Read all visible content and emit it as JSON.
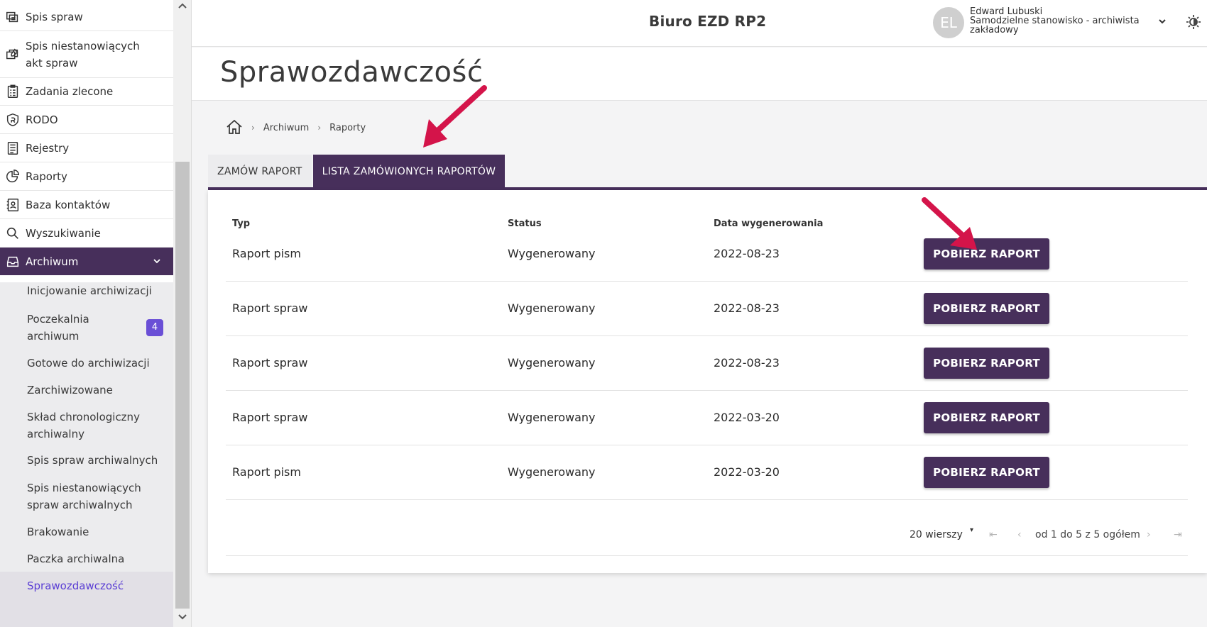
{
  "sidebar": {
    "items": [
      {
        "label": "Spis spraw",
        "icon": "folders-icon"
      },
      {
        "label": "Spis niestanowiących akt spraw",
        "icon": "folders-edit-icon"
      },
      {
        "label": "Zadania zlecone",
        "icon": "clipboard-icon"
      },
      {
        "label": "RODO",
        "icon": "shield-icon"
      },
      {
        "label": "Rejestry",
        "icon": "register-icon"
      },
      {
        "label": "Raporty",
        "icon": "pie-chart-icon"
      },
      {
        "label": "Baza kontaktów",
        "icon": "contacts-icon"
      },
      {
        "label": "Wyszukiwanie",
        "icon": "search-icon"
      },
      {
        "label": "Archiwum",
        "icon": "archive-icon"
      }
    ],
    "archive_sub": [
      {
        "label": "Inicjowanie archiwizacji"
      },
      {
        "label": "Poczekalnia archiwum",
        "badge": "4"
      },
      {
        "label": "Gotowe do archiwizacji"
      },
      {
        "label": "Zarchiwizowane"
      },
      {
        "label": "Skład chronologiczny archiwalny"
      },
      {
        "label": "Spis spraw archiwalnych"
      },
      {
        "label": "Spis niestanowiących spraw archiwalnych"
      },
      {
        "label": "Brakowanie"
      },
      {
        "label": "Paczka archiwalna"
      },
      {
        "label": "Sprawozdawczość"
      }
    ]
  },
  "header": {
    "app_title": "Biuro EZD RP2",
    "avatar_initials": "EL",
    "user_name": "Edward Lubuski",
    "user_role_line1": "Samodzielne stanowisko - archiwista",
    "user_role_line2": "zakładowy"
  },
  "page": {
    "title": "Sprawozdawczość",
    "breadcrumb": [
      "Archiwum",
      "Raporty"
    ]
  },
  "tabs": [
    {
      "label": "ZAMÓW RAPORT",
      "active": false
    },
    {
      "label": "LISTA ZAMÓWIONYCH RAPORTÓW",
      "active": true
    }
  ],
  "table": {
    "columns": [
      "Typ",
      "Status",
      "Data wygenerowania"
    ],
    "rows": [
      {
        "typ": "Raport pism",
        "status": "Wygenerowany",
        "data": "2022-08-23",
        "action": "POBIERZ RAPORT"
      },
      {
        "typ": "Raport spraw",
        "status": "Wygenerowany",
        "data": "2022-08-23",
        "action": "POBIERZ RAPORT"
      },
      {
        "typ": "Raport spraw",
        "status": "Wygenerowany",
        "data": "2022-08-23",
        "action": "POBIERZ RAPORT"
      },
      {
        "typ": "Raport spraw",
        "status": "Wygenerowany",
        "data": "2022-03-20",
        "action": "POBIERZ RAPORT"
      },
      {
        "typ": "Raport pism",
        "status": "Wygenerowany",
        "data": "2022-03-20",
        "action": "POBIERZ RAPORT"
      }
    ]
  },
  "pager": {
    "rows_per_page": "20 wierszy",
    "range": "od 1 do 5 z 5 ogółem"
  },
  "colors": {
    "brand": "#472f5b",
    "badge": "#6a4fd6",
    "active_link": "#5b3fd4",
    "annotation_arrow": "#d4144a"
  }
}
